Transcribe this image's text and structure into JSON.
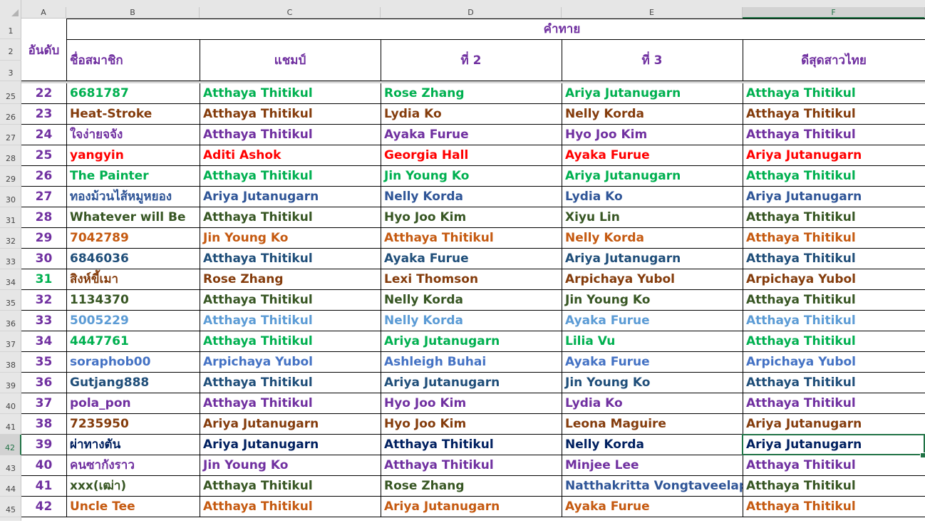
{
  "columns": [
    "A",
    "B",
    "C",
    "D",
    "E",
    "F"
  ],
  "selected_column": "F",
  "header_rows": [
    "1",
    "2",
    "3"
  ],
  "header": {
    "rank": "อันดับ",
    "member": "ชื่อสมาชิก",
    "prediction": "คำทาย",
    "champion": "แชมป์",
    "second": "ที่ 2",
    "third": "ที่ 3",
    "best_thai": "ดีสุดสาวไทย"
  },
  "header_color": "#7030a0",
  "selected_row": "42",
  "rows": [
    {
      "row": "25",
      "rank": "22",
      "member": "6681787",
      "champion": "Atthaya Thitikul",
      "second": "Rose Zhang",
      "third": "Ariya Jutanugarn",
      "best": "Atthaya Thitikul",
      "color": "#00b050"
    },
    {
      "row": "26",
      "rank": "23",
      "member": "Heat-Stroke",
      "champion": "Atthaya Thitikul",
      "second": "Lydia Ko",
      "third": "Nelly Korda",
      "best": "Atthaya Thitikul",
      "color": "#843c0c"
    },
    {
      "row": "27",
      "rank": "24",
      "member": "ใจง่ายจจัง",
      "champion": "Atthaya Thitikul",
      "second": "Ayaka Furue",
      "third": "Hyo Joo Kim",
      "best": "Atthaya Thitikul",
      "color": "#7030a0"
    },
    {
      "row": "28",
      "rank": "25",
      "member": "yangyin",
      "champion": "Aditi Ashok",
      "second": "Georgia Hall",
      "third": "Ayaka Furue",
      "best": "Ariya Jutanugarn",
      "color": "#ff0000"
    },
    {
      "row": "29",
      "rank": "26",
      "member": "The Painter",
      "champion": "Atthaya Thitikul",
      "second": "Jin Young Ko",
      "third": "Ariya Jutanugarn",
      "best": "Atthaya Thitikul",
      "color": "#00b050"
    },
    {
      "row": "30",
      "rank": "27",
      "member": "ทองม้วนไส้หมูหยอง",
      "champion": "Ariya Jutanugarn",
      "second": "Nelly Korda",
      "third": "Lydia Ko",
      "best": "Ariya Jutanugarn",
      "color": "#2f5597"
    },
    {
      "row": "31",
      "rank": "28",
      "member": "Whatever will Be",
      "champion": "Atthaya Thitikul",
      "second": "Hyo Joo Kim",
      "third": "Xiyu Lin",
      "best": "Atthaya Thitikul",
      "color": "#375623"
    },
    {
      "row": "32",
      "rank": "29",
      "member": "7042789",
      "champion": "Jin Young Ko",
      "second": "Atthaya Thitikul",
      "third": "Nelly Korda",
      "best": "Atthaya Thitikul",
      "color": "#c55a11"
    },
    {
      "row": "33",
      "rank": "30",
      "member": "6846036",
      "champion": "Atthaya Thitikul",
      "second": "Ayaka Furue",
      "third": "Ariya Jutanugarn",
      "best": "Atthaya Thitikul",
      "color": "#1f4e79"
    },
    {
      "row": "34",
      "rank": "31",
      "member": "สิงห์ขี้เมา",
      "champion": "Rose Zhang",
      "second": "Lexi Thomson",
      "third": "Arpichaya Yubol",
      "best": "Arpichaya Yubol",
      "color": "#843c0c",
      "rank_color": "#00b050"
    },
    {
      "row": "35",
      "rank": "32",
      "member": "1134370",
      "champion": "Atthaya Thitikul",
      "second": "Nelly Korda",
      "third": "Jin Young Ko",
      "best": "Atthaya Thitikul",
      "color": "#375623"
    },
    {
      "row": "36",
      "rank": "33",
      "member": "5005229",
      "champion": "Atthaya Thitikul",
      "second": "Nelly Korda",
      "third": "Ayaka Furue",
      "best": "Atthaya Thitikul",
      "color": "#5b9bd5"
    },
    {
      "row": "37",
      "rank": "34",
      "member": "4447761",
      "champion": "Atthaya Thitikul",
      "second": "Ariya Jutanugarn",
      "third": "Lilia Vu",
      "best": "Atthaya Thitikul",
      "color": "#00b050"
    },
    {
      "row": "38",
      "rank": "35",
      "member": "soraphob00",
      "champion": "Arpichaya Yubol",
      "second": "Ashleigh Buhai",
      "third": "Ayaka Furue",
      "best": "Arpichaya Yubol",
      "color": "#4472c4"
    },
    {
      "row": "39",
      "rank": "36",
      "member": "Gutjang888",
      "champion": "Atthaya Thitikul",
      "second": "Ariya Jutanugarn",
      "third": "Jin Young Ko",
      "best": "Atthaya Thitikul",
      "color": "#1f4e79"
    },
    {
      "row": "40",
      "rank": "37",
      "member": "pola_pon",
      "champion": "Atthaya Thitikul",
      "second": "Hyo Joo Kim",
      "third": "Lydia Ko",
      "best": "Atthaya Thitikul",
      "color": "#7030a0"
    },
    {
      "row": "41",
      "rank": "38",
      "member": "7235950",
      "champion": "Ariya Jutanugarn",
      "second": "Hyo Joo Kim",
      "third": "Leona Maguire",
      "best": "Ariya Jutanugarn",
      "color": "#843c0c"
    },
    {
      "row": "42",
      "rank": "39",
      "member": "ผ่าทางตัน",
      "champion": "Ariya Jutanugarn",
      "second": "Atthaya Thitikul",
      "third": "Nelly Korda",
      "best": "Ariya Jutanugarn",
      "color": "#002060"
    },
    {
      "row": "43",
      "rank": "40",
      "member": "คนซากังราว",
      "champion": "Jin Young Ko",
      "second": "Atthaya Thitikul",
      "third": "Minjee Lee",
      "best": "Atthaya Thitikul",
      "color": "#7030a0"
    },
    {
      "row": "44",
      "rank": "41",
      "member": "xxx(เฒ่า)",
      "champion": "Atthaya Thitikul",
      "second": "Rose Zhang",
      "third": "Natthakritta Vongtaveelap",
      "best": "Atthaya Thitikul",
      "color": "#375623",
      "third_color": "#2f5597"
    },
    {
      "row": "45",
      "rank": "42",
      "member": "Uncle Tee",
      "champion": "Atthaya Thitikul",
      "second": "Ariya Jutanugarn",
      "third": "Ayaka Furue",
      "best": "Atthaya Thitikul",
      "color": "#c55a11"
    }
  ]
}
